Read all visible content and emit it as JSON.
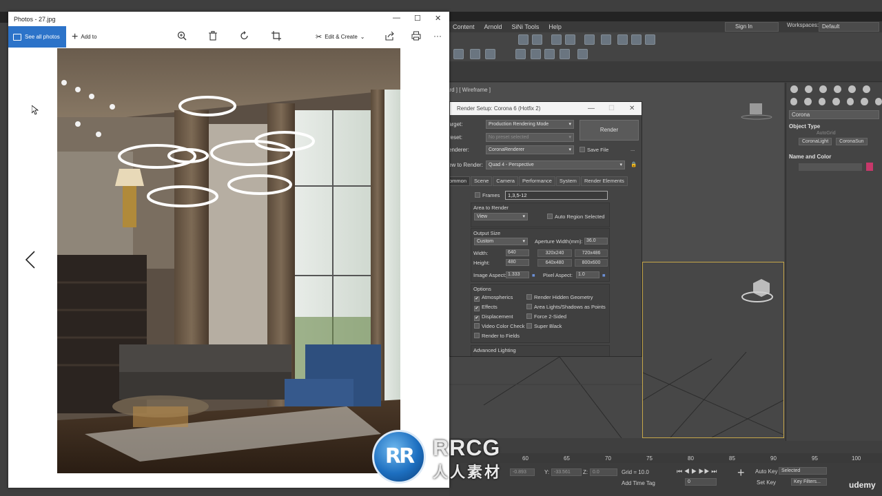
{
  "photos": {
    "title": "Photos - 27.jpg",
    "see_all": "See all photos",
    "add_to": "Add to",
    "edit_create": "Edit & Create",
    "toolbar_icons": [
      "zoom-icon",
      "delete-icon",
      "rotate-icon",
      "crop-icon",
      "share-icon",
      "print-icon",
      "more-icon"
    ]
  },
  "max": {
    "menus": [
      "Content",
      "Arnold",
      "SiNi Tools",
      "Help"
    ],
    "sign_in": "Sign In",
    "workspaces_label": "Workspaces:",
    "workspace_value": "Default",
    "viewport_label": "ard ] [ Wireframe ]",
    "command_panel": {
      "renderer_dd": "Corona",
      "object_type": "Object Type",
      "autogrid": "AutoGrid",
      "btn_light": "CoronaLight",
      "btn_sun": "CoronaSun",
      "name_color": "Name and Color"
    },
    "timeline_ticks": [
      "60",
      "65",
      "70",
      "75",
      "80",
      "85",
      "90",
      "95",
      "100"
    ],
    "status": {
      "x_label": "Y:",
      "x_value": "-0.893",
      "y_value": "-33.561",
      "z_label": "Z:",
      "z_value": "0.0",
      "grid": "Grid = 10.0",
      "add_time_tag": "Add Time Tag",
      "frame": "0",
      "auto_key": "Auto Key",
      "selected": "Selected",
      "set_key": "Set Key",
      "key_filters": "Key Filters..."
    }
  },
  "render_setup": {
    "title": "Render Setup: Corona 6 (Hotfix 2)",
    "target_label": "arget:",
    "target_value": "Production Rendering Mode",
    "preset_label": "reset:",
    "preset_value": "No preset selected",
    "renderer_label": "enderer:",
    "renderer_value": "CoronaRenderer",
    "save_file": "Save File",
    "view_label": "ew to Render:",
    "view_value": "Quad 4 - Perspective",
    "render_btn": "Render",
    "tabs": [
      "ommon",
      "Scene",
      "Camera",
      "Performance",
      "System",
      "Render Elements"
    ],
    "frames_label": "Frames",
    "frames_value": "1,3,5-12",
    "area_to_render": "Area to Render",
    "area_value": "View",
    "auto_region": "Auto Region Selected",
    "output_size": "Output Size",
    "size_preset": "Custom",
    "aperture_label": "Aperture Width(mm):",
    "aperture_value": "36.0",
    "width_label": "Width:",
    "width_value": "640",
    "height_label": "Height:",
    "height_value": "480",
    "preset_btns": [
      "320x240",
      "720x486",
      "640x480",
      "800x600"
    ],
    "image_aspect_label": "Image Aspect:",
    "image_aspect_value": "1.333",
    "pixel_aspect_label": "Pixel Aspect:",
    "pixel_aspect_value": "1.0",
    "options": "Options",
    "opt_left": [
      {
        "label": "Atmospherics",
        "on": true
      },
      {
        "label": "Effects",
        "on": true
      },
      {
        "label": "Displacement",
        "on": true
      },
      {
        "label": "Video Color Check",
        "on": false
      },
      {
        "label": "Render to Fields",
        "on": false
      }
    ],
    "opt_right": [
      {
        "label": "Render Hidden Geometry",
        "on": false
      },
      {
        "label": "Area Lights/Shadows as Points",
        "on": false
      },
      {
        "label": "Force 2-Sided",
        "on": false
      },
      {
        "label": "Super Black",
        "on": false
      }
    ],
    "advanced_lighting": "Advanced Lighting"
  },
  "watermark": {
    "text1": "RRCG",
    "text2": "人人素材",
    "udemy": "udemy"
  }
}
